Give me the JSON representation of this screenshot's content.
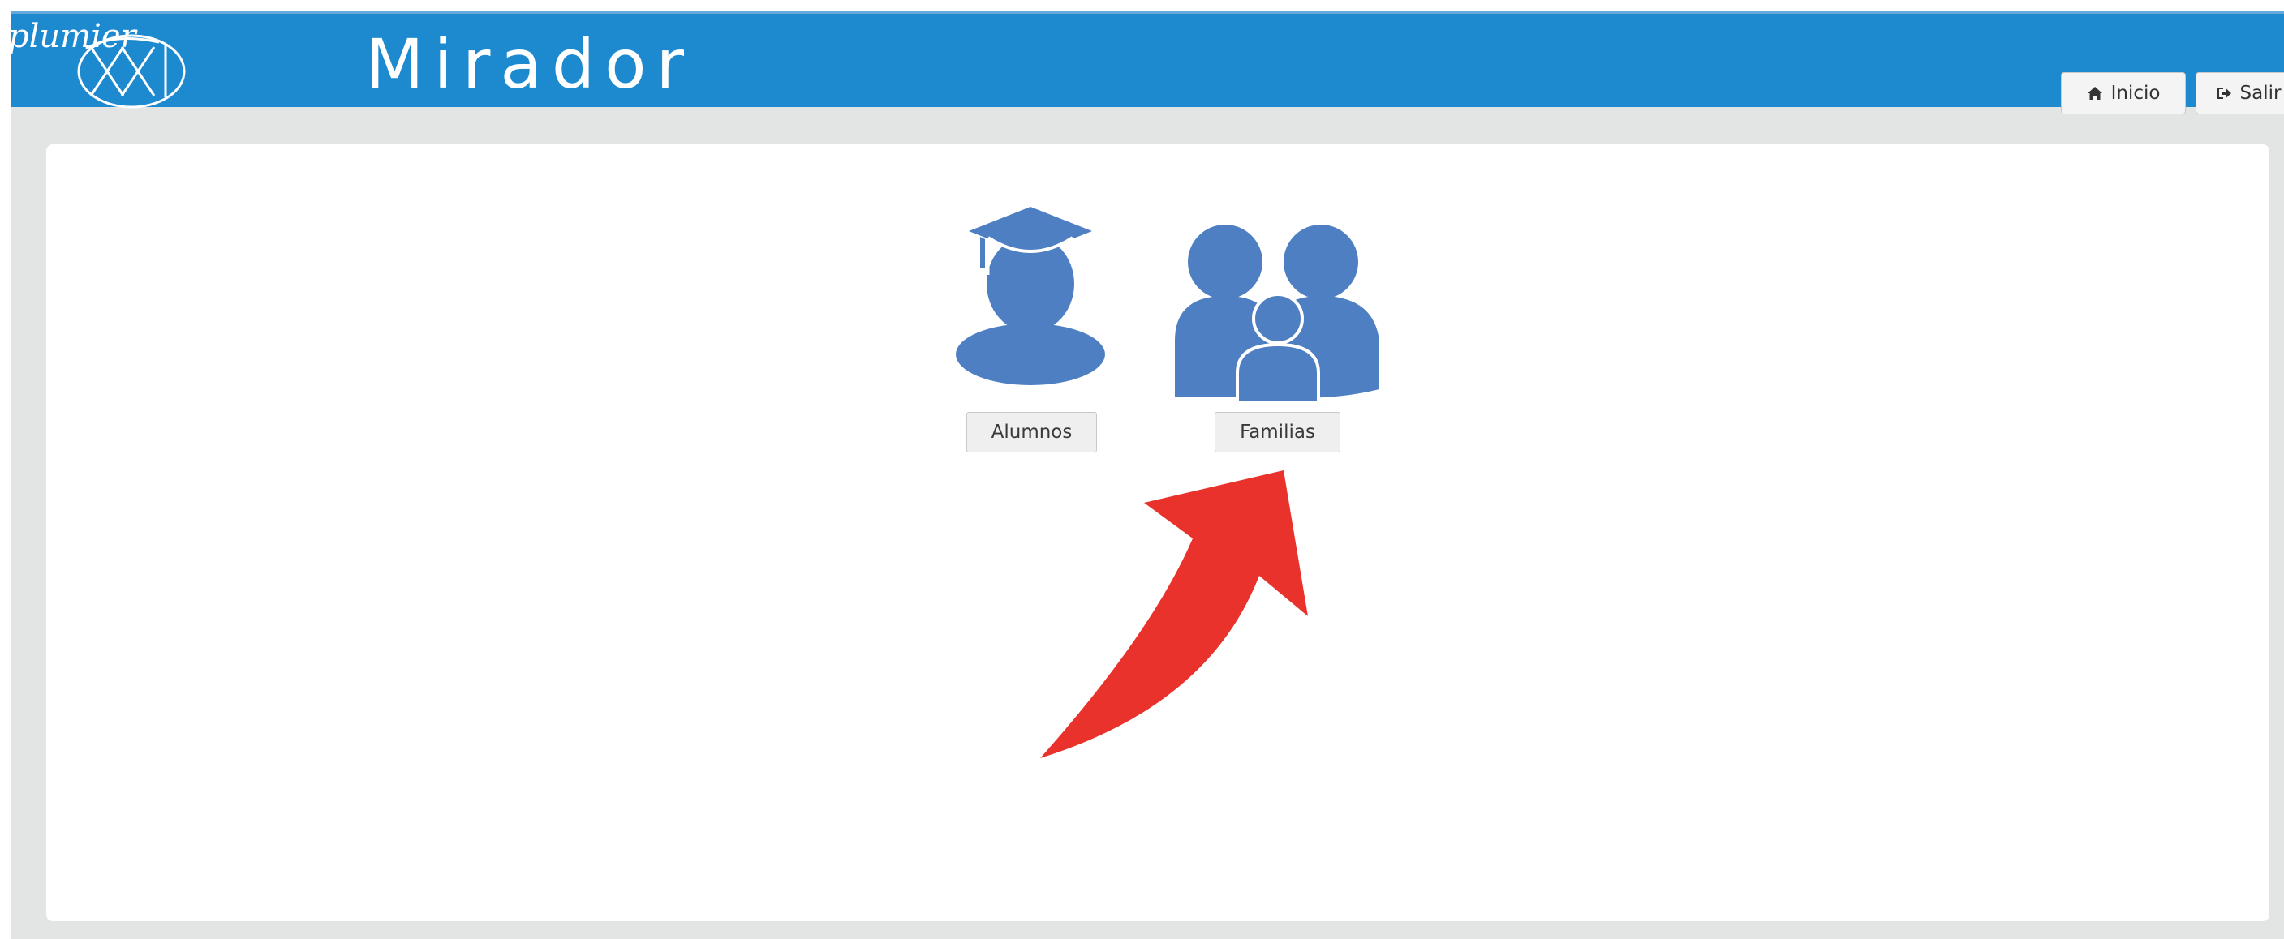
{
  "header": {
    "logo_text": "plumier XXI",
    "app_title": "Mirador",
    "buttons": {
      "home_label": "Inicio",
      "logout_label": "Salir"
    }
  },
  "modules": [
    {
      "label": "Alumnos",
      "icon": "student-graduation-icon"
    },
    {
      "label": "Familias",
      "icon": "family-icon"
    }
  ],
  "annotation": {
    "icon": "red-arrow-icon",
    "color": "#e9322b"
  },
  "colors": {
    "header_bg": "#1d89cf",
    "icon_blue": "#4f7fc3",
    "page_bg": "#e3e4e4"
  }
}
